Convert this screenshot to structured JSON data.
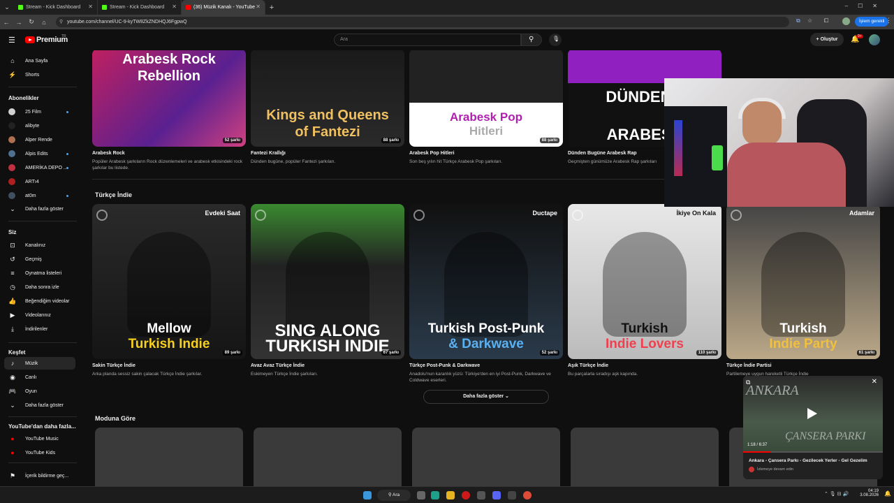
{
  "browser": {
    "tabs": [
      {
        "title": "Stream - Kick Dashboard",
        "color": "#53fc18"
      },
      {
        "title": "Stream - Kick Dashboard",
        "color": "#53fc18"
      },
      {
        "title": "(36) Müzik Kanalı - YouTube",
        "color": "#ff0000"
      }
    ],
    "url": "youtube.com/channel/UC-9-kyTW8ZkZNDHQJ6FgpwQ",
    "account_button": "İşlem gerekli"
  },
  "masthead": {
    "logo": "Premium",
    "logo_sup": "TR",
    "search_placeholder": "Ara",
    "create_label": "Oluştur",
    "notif_count": "9+"
  },
  "sidebar": {
    "home": "Ana Sayfa",
    "shorts": "Shorts",
    "subs_header": "Abonelikler",
    "subs": [
      {
        "name": "25 Film",
        "dot": true,
        "color": "#d0d0d0"
      },
      {
        "name": "alibyte",
        "dot": false,
        "color": "#222"
      },
      {
        "name": "Alper Rende",
        "dot": false,
        "color": "#b07050"
      },
      {
        "name": "Alpis Edits",
        "dot": true,
        "color": "#507090"
      },
      {
        "name": "AMERİKA DEPO ...",
        "dot": true,
        "color": "#c03040"
      },
      {
        "name": "ARTı4",
        "dot": false,
        "color": "#b02020"
      },
      {
        "name": "at0m",
        "dot": true,
        "color": "#405060"
      }
    ],
    "show_more": "Daha fazla göster",
    "you_header": "Siz",
    "you": [
      "Kanalınız",
      "Geçmiş",
      "Oynatma listeleri",
      "Daha sonra izle",
      "Beğendiğim videolar",
      "Videolarınız",
      "İndirilenler"
    ],
    "explore_header": "Keşfet",
    "explore": [
      "Müzik",
      "Canlı",
      "Oyun"
    ],
    "explore_more": "Daha fazla göster",
    "more_header": "YouTube'dan daha fazla...",
    "more": [
      "YouTube Music",
      "YouTube Kids"
    ],
    "report": "İçerik bildirme geç..."
  },
  "row1": [
    {
      "title": "Arabesk Rock",
      "desc": "Popüler Arabesk şarkıların Rock düzenlemeleri ve arabesk etkisindeki rock şarkılar bu listede.",
      "count": "52 şarkı",
      "art1": "Arabesk Rock",
      "art2": "Rebellion"
    },
    {
      "title": "Fantezi Krallığı",
      "desc": "Dünden bugüne, popüler Fantezi şarkıları.",
      "count": "88 şarkı",
      "art1": "Kings and Queens",
      "art2": "of Fantezi"
    },
    {
      "title": "Arabesk Pop Hitleri",
      "desc": "Son beş yılın hit Türkçe Arabesk Pop şarkıları.",
      "count": "88 şarkı",
      "art1": "Arabesk Pop",
      "art2": "Hitleri"
    },
    {
      "title": "Dünden Bugüne Arabesk Rap",
      "desc": "Geçmişten günümüze Arabesk Rap şarkıları",
      "count": "",
      "art1": "DÜNDENG",
      "art2": "ARABESK"
    }
  ],
  "section_indie": "Türkçe İndie",
  "row2": [
    {
      "title": "Sakin Türkçe İndie",
      "desc": "Arka planda sessiz sakin çalacak Türkçe İndie şarkılar.",
      "count": "89 şarkı",
      "artist": "Evdeki Saat",
      "art1": "Mellow",
      "art2": "Turkish Indie",
      "c2": "#f5d020"
    },
    {
      "title": "Avaz Avaz Türkçe İndie",
      "desc": "Eskimeyen Türkçe İndie şarkıları.",
      "count": "67 şarkı",
      "artist": "",
      "art1": "SING ALONG",
      "art2": "TURKISH INDIE",
      "c2": "#ffffff"
    },
    {
      "title": "Türkçe Post-Punk & Darkwave",
      "desc": "Anadolu'nun karanlık yüzü: Türkiye'den en iyi Post-Punk, Darkwave ve Coldwave eserleri.",
      "count": "52 şarkı",
      "artist": "Ductape",
      "art1": "Turkish Post-Punk",
      "art2": "& Darkwave",
      "c2": "#5ab0f0"
    },
    {
      "title": "Aşık Türkçe İndie",
      "desc": "Bu parçalarla sıradışı aşk kapında.",
      "count": "110 şarkı",
      "artist": "İkiye On Kala",
      "art1": "Turkish",
      "art2": "Indie Lovers",
      "c2": "#f04050"
    },
    {
      "title": "Türkçe İndie Partisi",
      "desc": "Partilemeye uygun hareketli Türkçe İndie",
      "count": "61 şarkı",
      "artist": "Adamlar",
      "art1": "Turkish",
      "art2": "Indie Party",
      "c2": "#f0c040"
    }
  ],
  "show_more_btn": "Daha fazla göster",
  "section_mood": "Moduna Göre",
  "miniplayer": {
    "time": "1:18 / 6:37",
    "title": "Ankara - Çansera Parkı - Gezilecek Yerler - Gel Gezelim",
    "subtitle": "İzlemeye devam edin",
    "overlay1": "ANKARA",
    "overlay2": "ÇANSERA PARKI",
    "progress": 0.2
  },
  "taskbar": {
    "search": "Ara",
    "time": "04:19",
    "date": "3.08.2026"
  }
}
